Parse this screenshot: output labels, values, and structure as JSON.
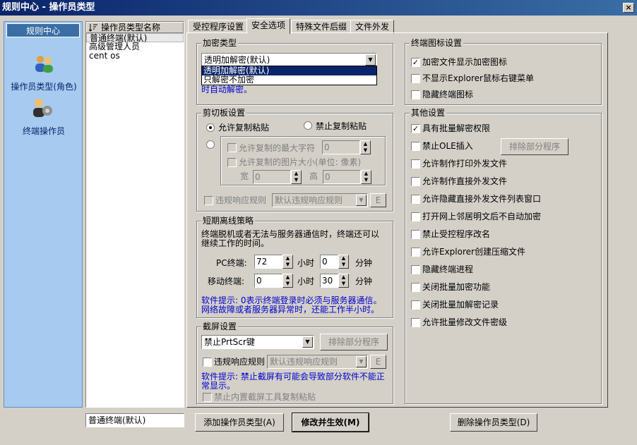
{
  "window": {
    "title": "规则中心 - 操作员类型",
    "close": "×"
  },
  "sidebar": {
    "header": "规则中心",
    "items": [
      {
        "label": "操作员类型(角色)",
        "icon": "users-icon"
      },
      {
        "label": "终端操作员",
        "icon": "user-gear-icon"
      }
    ]
  },
  "list": {
    "column": "操作员类型名称",
    "rows": [
      "普通终端(默认)",
      "高级管理人员",
      "cent os"
    ],
    "name_value": "普通终端(默认)"
  },
  "tabs": [
    "受控程序设置",
    "安全选项",
    "特殊文件后缀",
    "文件外发"
  ],
  "encrypt": {
    "title": "加密类型",
    "selected": "透明加解密(默认)",
    "options": [
      "透明加解密(默认)",
      "只解密不加密"
    ],
    "note_tail": "时自动解密。"
  },
  "clipboard": {
    "title": "剪切板设置",
    "allow": "允许复制粘贴",
    "deny": "禁止复制粘贴",
    "max_chars": "允许复制的最大字符",
    "max_chars_val": "0",
    "img_size": "允许复制的图片大小(单位: 像素)",
    "width_label": "宽",
    "width_val": "0",
    "height_label": "高",
    "height_val": "0",
    "violation": "违规响应规则",
    "violation_val": "默认违规响应规则",
    "e": "E"
  },
  "offline": {
    "title": "短期离线策略",
    "desc": "终端脱机或者无法与服务器通信时，终端还可以继续工作的时间。",
    "pc_label": "PC终端:",
    "pc_hours": "72",
    "hours": "小时",
    "pc_min": "0",
    "minutes": "分钟",
    "mobile_label": "移动终端:",
    "mobile_hours": "0",
    "mobile_min": "30",
    "tip": "软件提示: 0表示终端登录时必须与服务器通信。网络故障或者服务器异常时，还能工作半小时。"
  },
  "screen": {
    "title": "截屏设置",
    "selected": "禁止PrtScr键",
    "exclude": "排除部分程序",
    "violation": "违规响应规则",
    "violation_val": "默认违规响应规则",
    "e": "E",
    "tip": "软件提示: 禁止截屏有可能会导致部分软件不能正常显示。",
    "builtin": "禁止内置截屏工具复制粘贴"
  },
  "icons": {
    "title": "终端图标设置",
    "items": [
      {
        "label": "加密文件显示加密图标",
        "checked": true
      },
      {
        "label": "不显示Explorer鼠标右键菜单",
        "checked": false
      },
      {
        "label": "隐藏终端图标",
        "checked": false
      }
    ]
  },
  "other": {
    "title": "其他设置",
    "exclude": "排除部分程序",
    "items": [
      {
        "label": "具有批量解密权限",
        "checked": true
      },
      {
        "label": "禁止OLE插入",
        "checked": false
      },
      {
        "label": "允许制作打印外发文件",
        "checked": false
      },
      {
        "label": "允许制作直接外发文件",
        "checked": false
      },
      {
        "label": "允许隐藏直接外发文件列表窗口",
        "checked": false
      },
      {
        "label": "打开网上邻居明文后不自动加密",
        "checked": false
      },
      {
        "label": "禁止受控程序改名",
        "checked": false
      },
      {
        "label": "允许Explorer创建压缩文件",
        "checked": false
      },
      {
        "label": "隐藏终端进程",
        "checked": false
      },
      {
        "label": "关闭批量加密功能",
        "checked": false
      },
      {
        "label": "关闭批量加解密记录",
        "checked": false
      },
      {
        "label": "允许批量修改文件密级",
        "checked": false
      }
    ]
  },
  "buttons": {
    "add": "添加操作员类型(A)",
    "save": "修改并生效(M)",
    "delete": "删除操作员类型(D)"
  }
}
